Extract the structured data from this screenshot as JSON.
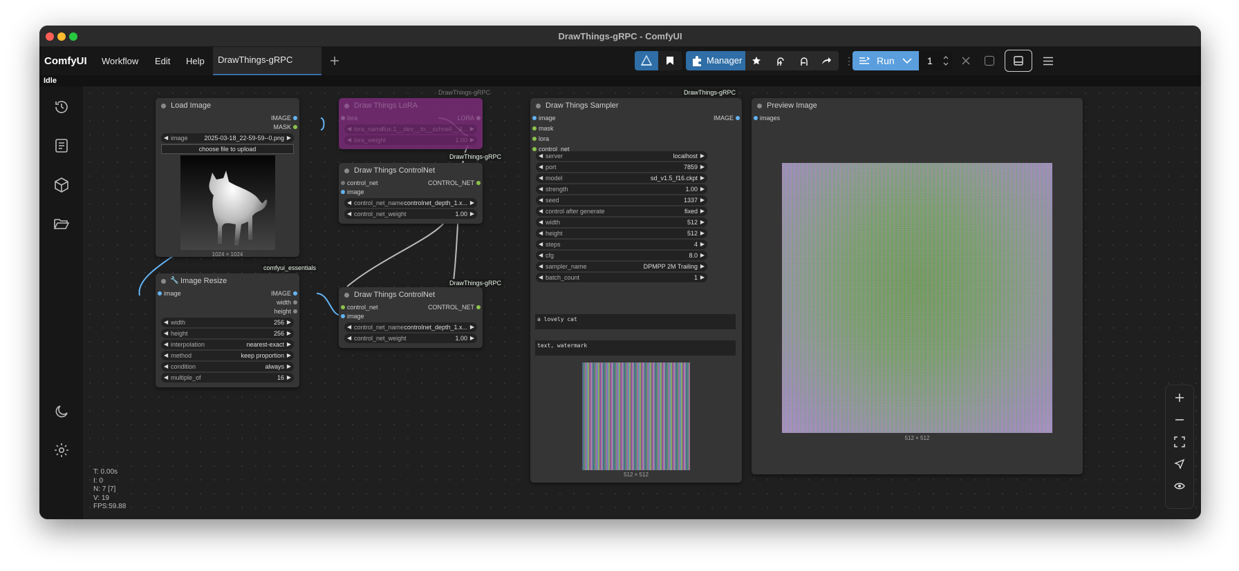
{
  "window": {
    "title": "DrawThings-gRPC - ComfyUI"
  },
  "menubar": {
    "logo": "ComfyUI",
    "menus": [
      "Workflow",
      "Edit",
      "Help"
    ],
    "active_tab": "DrawThings-gRPC",
    "new_tab_icon": "plus-icon",
    "manager_label": "Manager",
    "run_label": "Run",
    "queue_count": "1"
  },
  "status": "Idle",
  "sidebar": {
    "icons": [
      "history-icon",
      "book-icon",
      "cube-icon",
      "folder-icon"
    ],
    "bottom_icons": [
      "moon-icon",
      "gear-icon"
    ]
  },
  "stats": [
    "T: 0.00s",
    "I: 0",
    "N: 7 [7]",
    "V: 19",
    "FPS:59.88"
  ],
  "nodes": {
    "load_image": {
      "title": "Load Image",
      "outputs": [
        "IMAGE",
        "MASK"
      ],
      "image_label": "image",
      "image_value": "2025-03-18_22-59-59--0.png",
      "upload_label": "choose file to upload",
      "caption": "1024 × 1024"
    },
    "lora": {
      "badge": "DrawThings-gRPC",
      "title": "Draw Things LoRA",
      "input": "lora",
      "output": "LORA",
      "lora_name_label": "lora_name",
      "lora_name_value": "flux.1__dev__to__schnell__4...",
      "lora_weight_label": "lora_weight",
      "lora_weight_value": "1.00"
    },
    "controlnet1": {
      "badge": "DrawThings-gRPC",
      "title": "Draw Things ControlNet",
      "inputs": [
        "control_net",
        "image"
      ],
      "output": "CONTROL_NET",
      "name_label": "control_net_name",
      "name_value": "controlnet_depth_1.x...",
      "weight_label": "control_net_weight",
      "weight_value": "1.00"
    },
    "controlnet2": {
      "badge": "DrawThings-gRPC",
      "title": "Draw Things ControlNet",
      "inputs": [
        "control_net",
        "image"
      ],
      "output": "CONTROL_NET",
      "name_label": "control_net_name",
      "name_value": "controlnet_depth_1.x...",
      "weight_label": "control_net_weight",
      "weight_value": "1.00"
    },
    "resize": {
      "badge": "comfyui_essentials",
      "title": "Image Resize",
      "input": "image",
      "outputs": [
        "IMAGE",
        "width",
        "height"
      ],
      "widgets": [
        {
          "label": "width",
          "value": "256"
        },
        {
          "label": "height",
          "value": "256"
        },
        {
          "label": "interpolation",
          "value": "nearest-exact"
        },
        {
          "label": "method",
          "value": "keep proportion"
        },
        {
          "label": "condition",
          "value": "always"
        },
        {
          "label": "multiple_of",
          "value": "16"
        }
      ]
    },
    "sampler": {
      "badge": "DrawThings-gRPC",
      "title": "Draw Things Sampler",
      "inputs": [
        "image",
        "mask",
        "lora",
        "control_net"
      ],
      "output": "IMAGE",
      "widgets": [
        {
          "label": "server",
          "value": "localhost"
        },
        {
          "label": "port",
          "value": "7859"
        },
        {
          "label": "model",
          "value": "sd_v1.5_f16.ckpt"
        },
        {
          "label": "strength",
          "value": "1.00"
        },
        {
          "label": "seed",
          "value": "1337"
        },
        {
          "label": "control after generate",
          "value": "fixed"
        },
        {
          "label": "width",
          "value": "512"
        },
        {
          "label": "height",
          "value": "512"
        },
        {
          "label": "steps",
          "value": "4"
        },
        {
          "label": "cfg",
          "value": "8.0"
        },
        {
          "label": "sampler_name",
          "value": "DPMPP 2M Trailing"
        },
        {
          "label": "batch_count",
          "value": "1"
        }
      ],
      "positive_prompt": "a lovely cat",
      "negative_prompt": "text, watermark",
      "caption": "512 × 512"
    },
    "preview": {
      "title": "Preview Image",
      "input": "images",
      "caption": "512 × 512"
    }
  },
  "zoom_controls": [
    "zoom-in-icon",
    "zoom-out-icon",
    "fit-view-icon",
    "locate-icon",
    "eye-icon"
  ]
}
